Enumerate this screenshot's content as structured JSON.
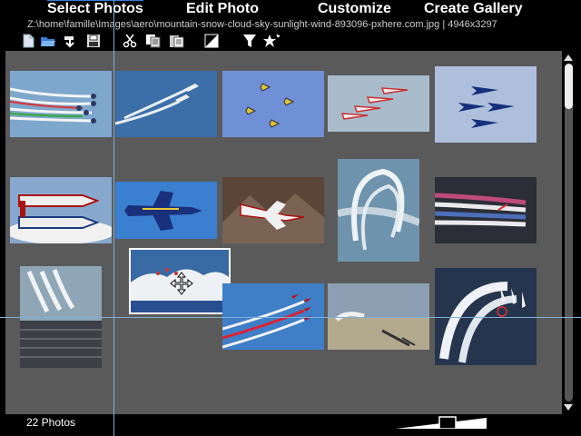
{
  "tabs": [
    {
      "label": "Select Photos",
      "active": true
    },
    {
      "label": "Edit Photo"
    },
    {
      "label": "Customize"
    },
    {
      "label": "Create Gallery"
    }
  ],
  "path_bar": "Z:\\home\\famille\\Images\\aero\\mountain-snow-cloud-sky-sunlight-wind-893096-pxhere.com.jpg | 4946x3297",
  "toolbar": {
    "icons": [
      "new-file-icon",
      "open-folder-icon",
      "import-icon",
      "save-icon",
      "cut-icon",
      "copy-icon",
      "paste-icon",
      "contrast-icon",
      "filter-icon",
      "sparkle-icon"
    ]
  },
  "photos": [
    "blue-angels-formation-smoke",
    "two-jets-smoke-trails",
    "four-yellow-jets-blue-sky",
    "red-white-jets-formation",
    "blue-angels-delta-formation",
    "thunderbirds-mirror-formation",
    "blue-hornet-jet",
    "thunderbird-over-mountains",
    "smoke-loop-sky",
    "colored-smoke-trails",
    "smoke-trails-over-building",
    "jets-over-clouds-selected",
    "red-arrows-smoke-trails",
    "jets-over-landscape",
    "smoke-arch-formation"
  ],
  "selected_photo": "jets-over-clouds-selected",
  "status": {
    "count": "22 Photos"
  },
  "colors": {
    "tab_accent": "#2f7fe0",
    "panel_bg": "#5a5a5a",
    "guide": "#7fb0d6"
  }
}
